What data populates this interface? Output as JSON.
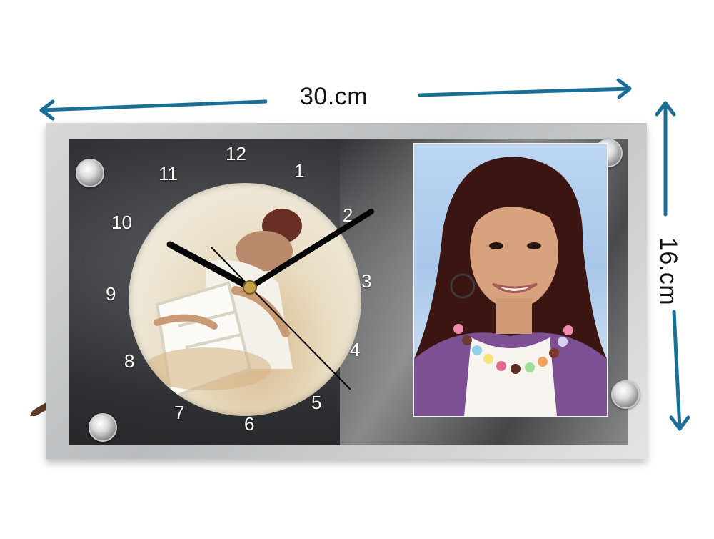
{
  "dimensions": {
    "width_label": "30.cm",
    "height_label": "16.cm",
    "arrow_color": "#1b6f96"
  },
  "clock": {
    "numbers": [
      "12",
      "1",
      "2",
      "3",
      "4",
      "5",
      "6",
      "7",
      "8",
      "9",
      "10",
      "11"
    ]
  },
  "colors": {
    "frame_dark": "#2f3033",
    "photo_background": "#a9c7ea"
  }
}
